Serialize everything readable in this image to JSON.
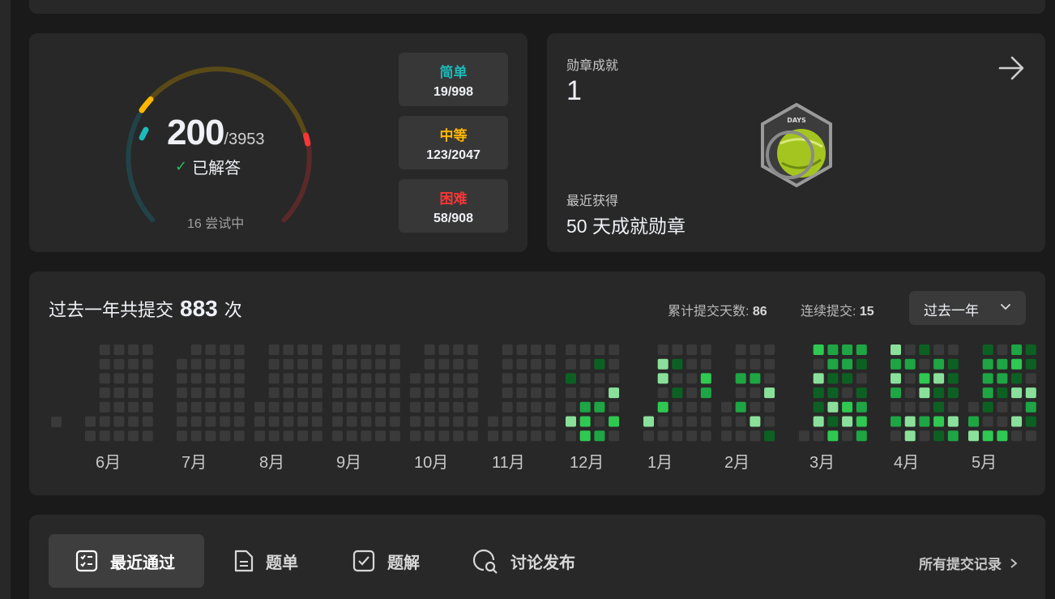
{
  "progress": {
    "solved": "200",
    "total": "/3953",
    "solved_label": "已解答",
    "attempting": "16 尝试中",
    "difficulties": [
      {
        "name": "简单",
        "count": "19/998",
        "color": "#1cbaba"
      },
      {
        "name": "中等",
        "count": "123/2047",
        "color": "#ffb700"
      },
      {
        "name": "困难",
        "count": "58/908",
        "color": "#f63737"
      }
    ]
  },
  "badges": {
    "title": "勋章成就",
    "count": "1",
    "recent_label": "最近获得",
    "recent_name": "50 天成就勋章",
    "badge_text": "DAYS"
  },
  "heatmap": {
    "title_prefix": "过去一年共提交",
    "total": "883",
    "title_suffix": "次",
    "days_label": "累计提交天数:",
    "days_value": "86",
    "streak_label": "连续提交:",
    "streak_value": "15",
    "range": "过去一年",
    "months": [
      "6月",
      "7月",
      "8月",
      "9月",
      "10月",
      "11月",
      "12月",
      "1月",
      "2月",
      "3月",
      "4月",
      "5月"
    ],
    "colors": [
      "#3a3a3a",
      "#0c6122",
      "#1ea544",
      "#2fc952",
      "#8ae09b"
    ]
  },
  "tabs": {
    "items": [
      "最近通过",
      "题单",
      "题解",
      "讨论发布"
    ],
    "all_submissions": "所有提交记录"
  },
  "colors": {
    "accent_green": "#2cbb5d",
    "easy": "#1cbaba",
    "medium": "#ffb700",
    "hard": "#f63737"
  }
}
